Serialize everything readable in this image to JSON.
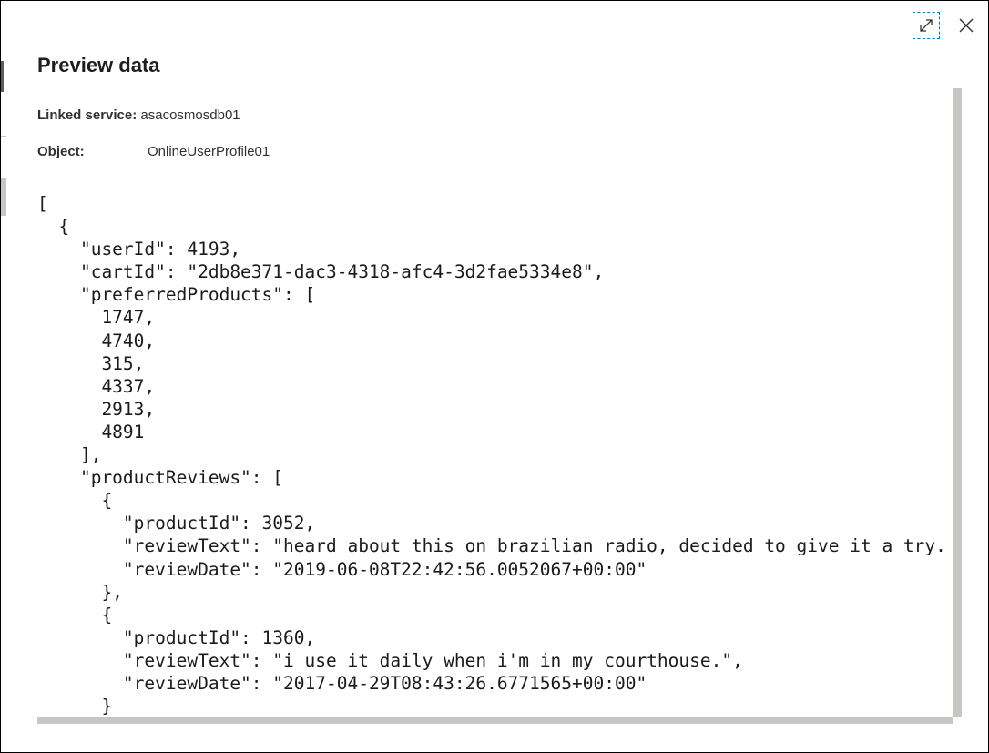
{
  "panel": {
    "title": "Preview data",
    "linked_service_label": "Linked service:",
    "linked_service_value": "asacosmosdb01",
    "object_label": "Object:",
    "object_value": "OnlineUserProfile01",
    "expand_icon": "expand-diagonal-icon",
    "close_icon": "close-icon"
  },
  "json_preview": {
    "lines": [
      "[",
      "  {",
      "    \"userId\": 4193,",
      "    \"cartId\": \"2db8e371-dac3-4318-afc4-3d2fae5334e8\",",
      "    \"preferredProducts\": [",
      "      1747,",
      "      4740,",
      "      315,",
      "      4337,",
      "      2913,",
      "      4891",
      "    ],",
      "    \"productReviews\": [",
      "      {",
      "        \"productId\": 3052,",
      "        \"reviewText\": \"heard about this on brazilian radio, decided to give it a try.",
      "        \"reviewDate\": \"2019-06-08T22:42:56.0052067+00:00\"",
      "      },",
      "      {",
      "        \"productId\": 1360,",
      "        \"reviewText\": \"i use it daily when i'm in my courthouse.\",",
      "        \"reviewDate\": \"2017-04-29T08:43:26.6771565+00:00\"",
      "      }"
    ]
  },
  "colors": {
    "accent": "#0078d4",
    "text": "#323130",
    "scrollbar": "#c8c6c4"
  }
}
